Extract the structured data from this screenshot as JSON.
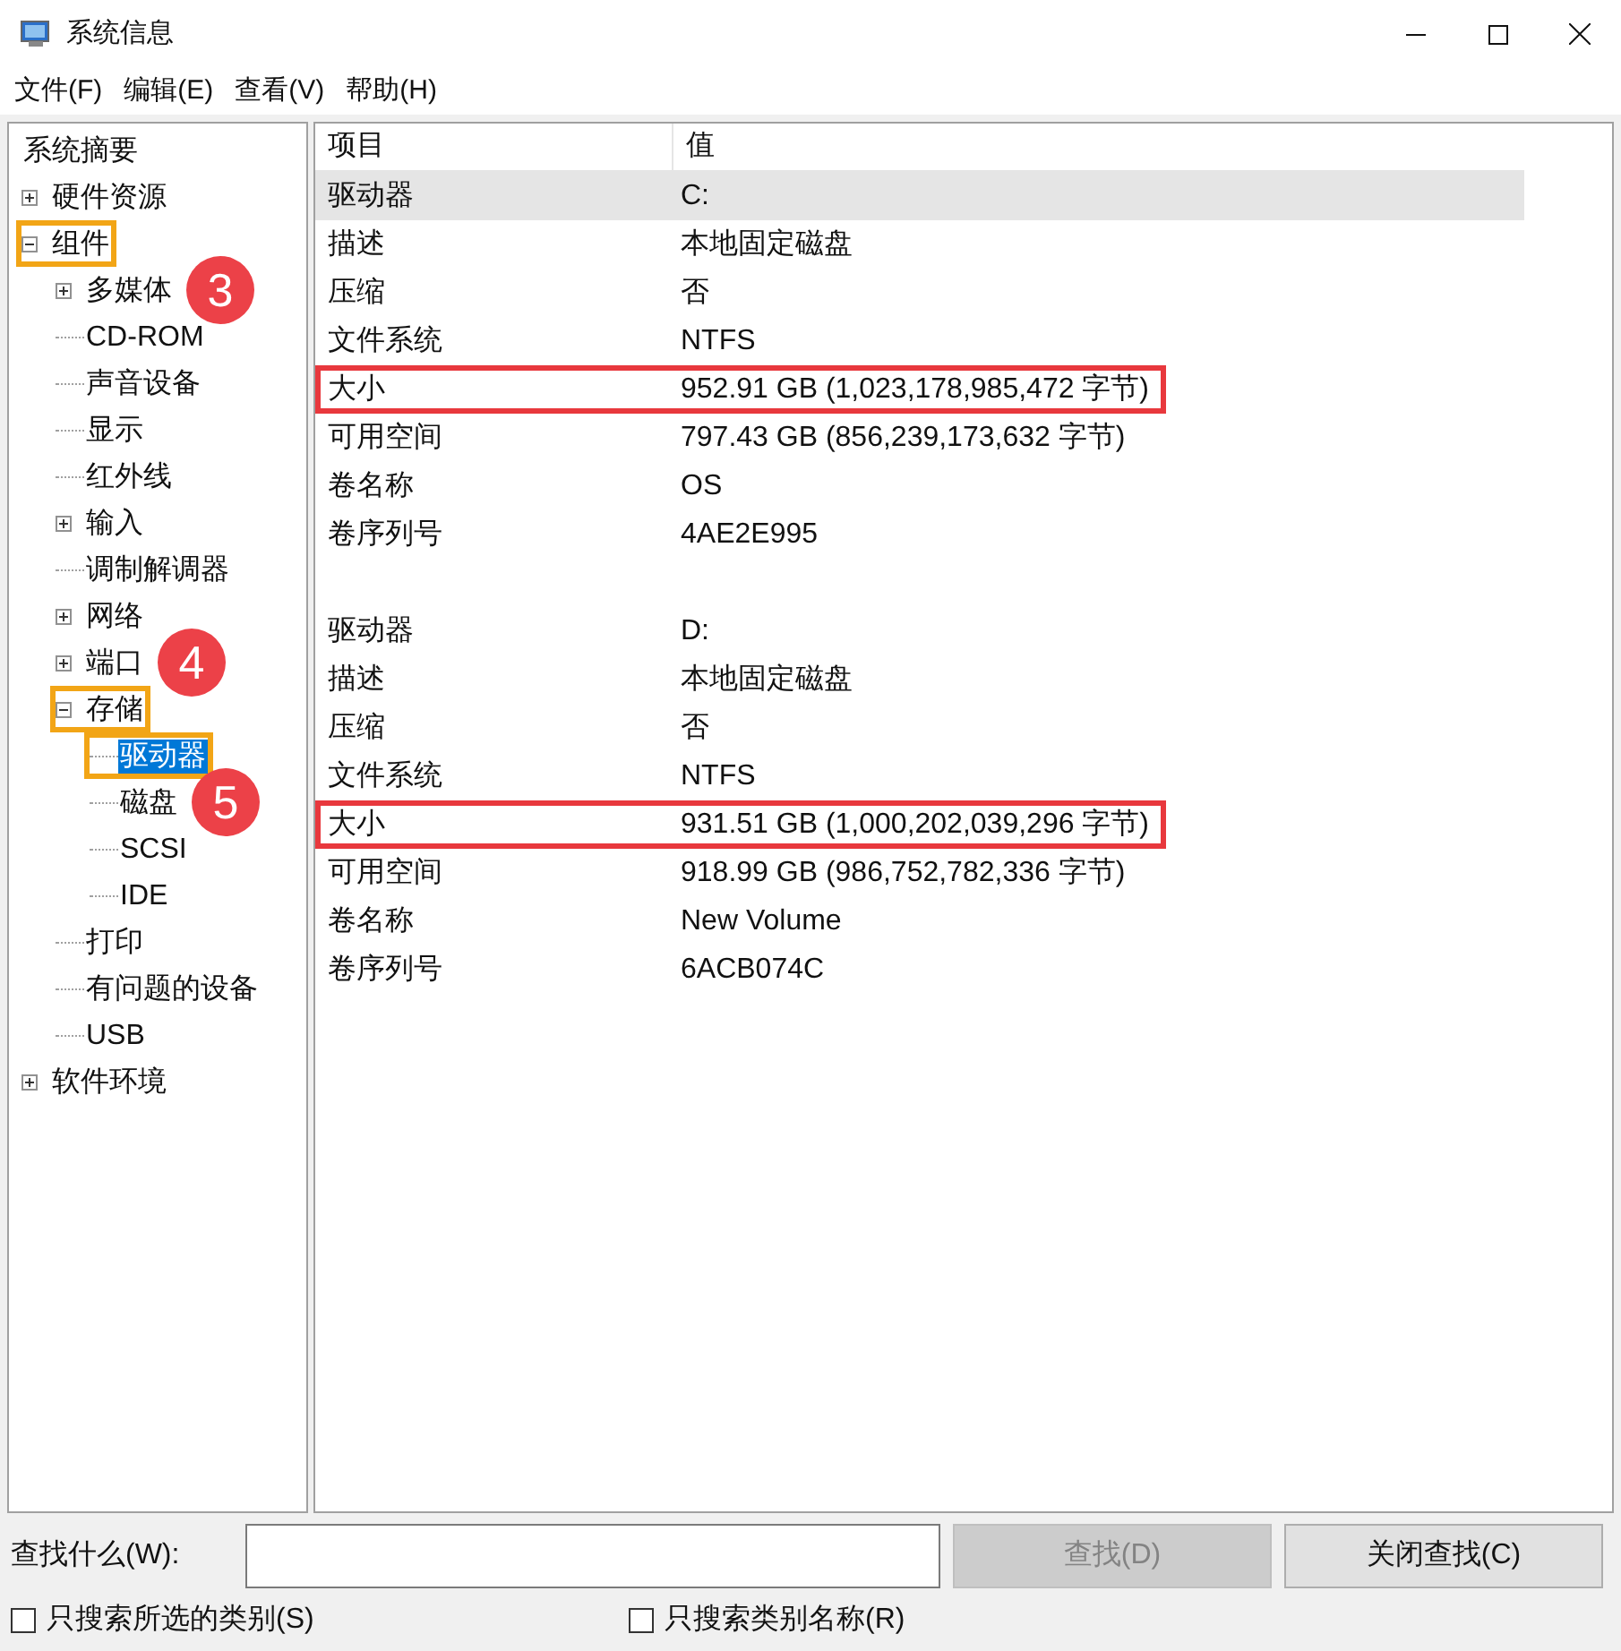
{
  "window": {
    "title": "系统信息"
  },
  "menu": [
    {
      "label": "文件(F)"
    },
    {
      "label": "编辑(E)"
    },
    {
      "label": "查看(V)"
    },
    {
      "label": "帮助(H)"
    }
  ],
  "tree": [
    {
      "label": "系统摘要",
      "selected": false,
      "highlighted": false
    },
    {
      "label": "硬件资源",
      "expanded": false,
      "selected": false,
      "highlighted": false
    },
    {
      "label": "组件",
      "expanded": true,
      "selected": false,
      "highlighted": true,
      "children": [
        {
          "label": "多媒体",
          "expanded": false,
          "selected": false,
          "highlighted": false,
          "badge": "3"
        },
        {
          "label": "CD-ROM",
          "selected": false,
          "highlighted": false
        },
        {
          "label": "声音设备",
          "selected": false,
          "highlighted": false
        },
        {
          "label": "显示",
          "selected": false,
          "highlighted": false
        },
        {
          "label": "红外线",
          "selected": false,
          "highlighted": false
        },
        {
          "label": "输入",
          "expanded": false,
          "selected": false,
          "highlighted": false
        },
        {
          "label": "调制解调器",
          "selected": false,
          "highlighted": false
        },
        {
          "label": "网络",
          "expanded": false,
          "selected": false,
          "highlighted": false
        },
        {
          "label": "端口",
          "expanded": false,
          "selected": false,
          "highlighted": false,
          "badge": "4"
        },
        {
          "label": "存储",
          "expanded": true,
          "selected": false,
          "highlighted": true,
          "children": [
            {
              "label": "驱动器",
              "selected": true,
              "highlighted": true
            },
            {
              "label": "磁盘",
              "selected": false,
              "highlighted": false,
              "badge": "5"
            },
            {
              "label": "SCSI",
              "selected": false,
              "highlighted": false
            },
            {
              "label": "IDE",
              "selected": false,
              "highlighted": false
            }
          ]
        },
        {
          "label": "打印",
          "selected": false,
          "highlighted": false
        },
        {
          "label": "有问题的设备",
          "selected": false,
          "highlighted": false
        },
        {
          "label": "USB",
          "selected": false,
          "highlighted": false
        }
      ]
    },
    {
      "label": "软件环境",
      "expanded": false,
      "selected": false,
      "highlighted": false
    }
  ],
  "table": {
    "columns": [
      "项目",
      "值"
    ],
    "groups": [
      {
        "rows": [
          {
            "cells": [
              "驱动器",
              "C:"
            ],
            "selected": true,
            "highlighted": false
          },
          {
            "cells": [
              "描述",
              "本地固定磁盘"
            ],
            "selected": false,
            "highlighted": false
          },
          {
            "cells": [
              "压缩",
              "否"
            ],
            "selected": false,
            "highlighted": false
          },
          {
            "cells": [
              "文件系统",
              "NTFS"
            ],
            "selected": false,
            "highlighted": false
          },
          {
            "cells": [
              "大小",
              "952.91 GB (1,023,178,985,472 字节)"
            ],
            "selected": false,
            "highlighted": true
          },
          {
            "cells": [
              "可用空间",
              "797.43 GB (856,239,173,632 字节)"
            ],
            "selected": false,
            "highlighted": false
          },
          {
            "cells": [
              "卷名称",
              "OS"
            ],
            "selected": false,
            "highlighted": false
          },
          {
            "cells": [
              "卷序列号",
              "4AE2E995"
            ],
            "selected": false,
            "highlighted": false
          }
        ]
      },
      {
        "rows": [
          {
            "cells": [
              "驱动器",
              "D:"
            ],
            "selected": false,
            "highlighted": false
          },
          {
            "cells": [
              "描述",
              "本地固定磁盘"
            ],
            "selected": false,
            "highlighted": false
          },
          {
            "cells": [
              "压缩",
              "否"
            ],
            "selected": false,
            "highlighted": false
          },
          {
            "cells": [
              "文件系统",
              "NTFS"
            ],
            "selected": false,
            "highlighted": false
          },
          {
            "cells": [
              "大小",
              "931.51 GB (1,000,202,039,296 字节)"
            ],
            "selected": false,
            "highlighted": true
          },
          {
            "cells": [
              "可用空间",
              "918.99 GB (986,752,782,336 字节)"
            ],
            "selected": false,
            "highlighted": false
          },
          {
            "cells": [
              "卷名称",
              "New Volume"
            ],
            "selected": false,
            "highlighted": false
          },
          {
            "cells": [
              "卷序列号",
              "6ACB074C"
            ],
            "selected": false,
            "highlighted": false
          }
        ]
      }
    ]
  },
  "find_bar": {
    "label": "查找什么(W):",
    "buttons": [
      {
        "label": "查找(D)",
        "disabled": true
      },
      {
        "label": "关闭查找(C)",
        "disabled": false
      }
    ],
    "checkboxes": [
      {
        "label": "只搜索所选的类别(S)",
        "checked": false
      },
      {
        "label": "只搜索类别名称(R)",
        "checked": false
      }
    ]
  }
}
